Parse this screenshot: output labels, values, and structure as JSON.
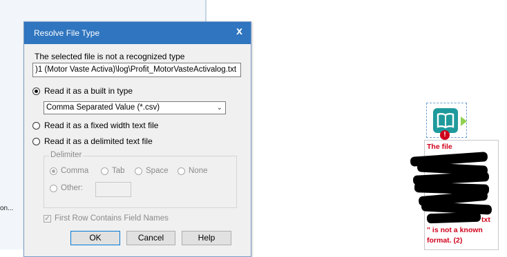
{
  "background": {
    "truncated_text": "on..."
  },
  "dialog": {
    "title": "Resolve File Type",
    "close_glyph": "x",
    "message": "The selected file is not a recognized type",
    "file_path": ")1 (Motor Vaste Activa)\\log\\Profit_MotorVasteActivalog.txt",
    "options": {
      "builtin_label": "Read it as a built in type",
      "builtin_selected": true,
      "builtin_type_value": "Comma Separated Value (*.csv)",
      "fixed_width_label": "Read it as a fixed width text file",
      "delimited_label": "Read it as a delimited text file"
    },
    "delimiter": {
      "group_label": "Delimiter",
      "comma": "Comma",
      "tab": "Tab",
      "space": "Space",
      "none": "None",
      "other": "Other:",
      "selected": "Comma"
    },
    "first_row_label": "First Row Contains Field Names",
    "first_row_checked": true,
    "buttons": {
      "ok": "OK",
      "cancel": "Cancel",
      "help": "Help"
    }
  },
  "workflow_tool": {
    "error_glyph": "!",
    "annotation_line1": "The file",
    "annotation_line2": "txt",
    "annotation_line3": "\" is not a known",
    "annotation_line4": "format. (2)",
    "error_color": "#d0021b",
    "icon_color": "#1f9a9c"
  }
}
